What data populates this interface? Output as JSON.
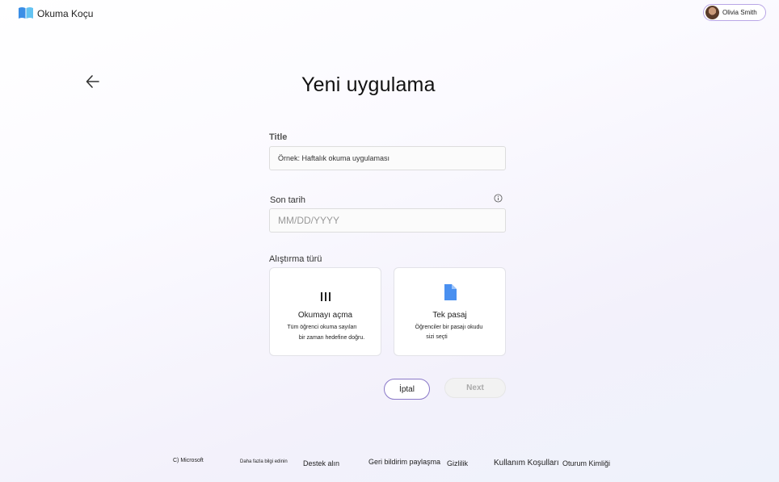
{
  "header": {
    "app_title": "Okuma Koçu",
    "user_name": "Olivia Smith"
  },
  "page": {
    "title": "Yeni uygulama"
  },
  "form": {
    "title_label": "Title",
    "title_value": "Örnek: Haftalık okuma uygulaması",
    "due_label": "Son tarih",
    "due_placeholder": "MM/DD/YYYY",
    "type_label": "Alıştırma türü",
    "cards": [
      {
        "title": "Okumayı açma",
        "desc_line1": "Tüm öğrenci okuma sayıları",
        "desc_line2": "bir zaman hedefine doğru.",
        "icon": "bars-icon"
      },
      {
        "title": "Tek pasaj",
        "desc_line1": "Öğrenciler bir pasajı okudu",
        "desc_line2": "sizi seçti",
        "icon": "document-icon"
      }
    ],
    "cancel_label": "İptal",
    "next_label": "Next"
  },
  "footer": {
    "copyright": "C) Microsoft",
    "learn_more": "Daha fazla bilgi edinin",
    "support": "Destek alın",
    "feedback": "Geri bildirim paylaşma",
    "privacy": "Gizlilik",
    "terms": "Kullanım Koşulları",
    "session": "Oturum Kimliği"
  },
  "colors": {
    "accent": "#8a78c8",
    "logo_blue": "#3a8ee6",
    "document_blue": "#4a90f0"
  }
}
